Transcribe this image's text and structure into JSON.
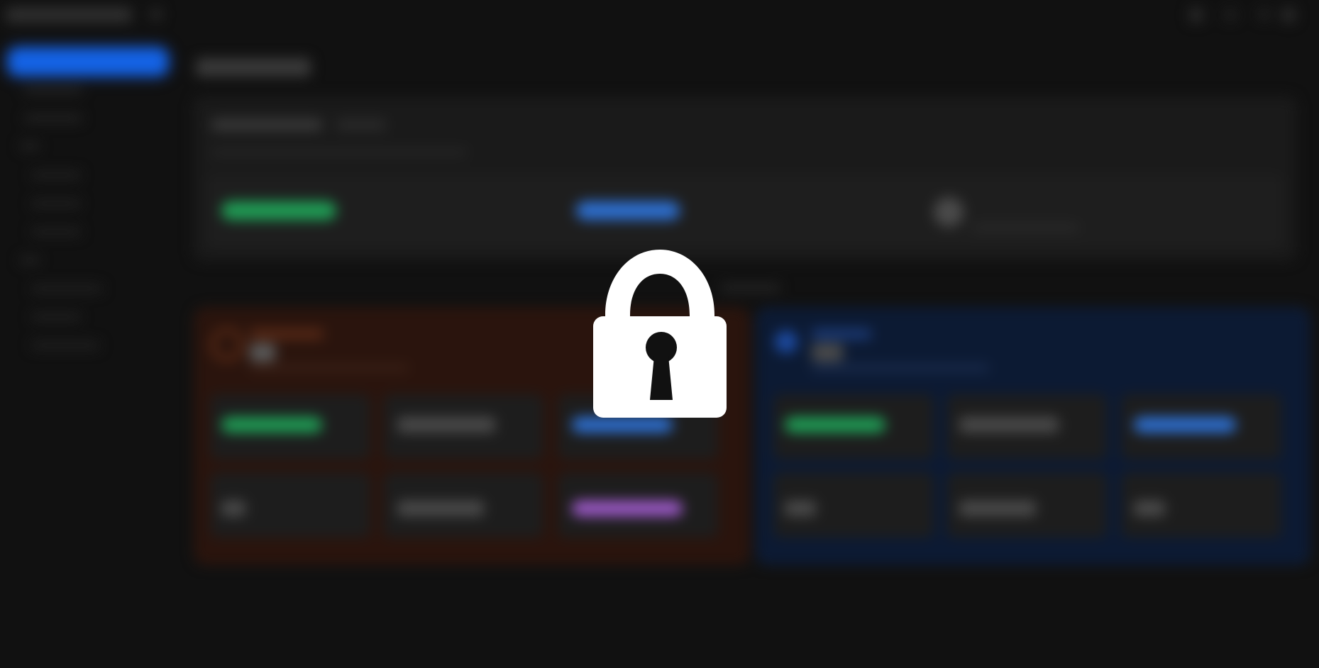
{
  "overlay": {
    "icon": "lock-icon",
    "state": "locked",
    "icon_color": "#ffffff"
  },
  "background_app": {
    "obscured": true,
    "theme": "dark",
    "accent_colors": {
      "primary_button": "#1463e6",
      "success_pill": "#1f9d55",
      "info_pill": "#2d6fd0",
      "purple_pill": "#9b59c6",
      "warning_panel": "#2a140d",
      "info_panel": "#0c1a33"
    }
  }
}
